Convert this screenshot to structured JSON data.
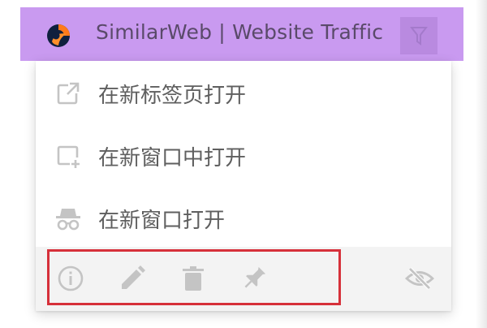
{
  "header": {
    "title": "SimilarWeb | Website Traffic",
    "brand_color": "#c99af0",
    "logo_icon": "similarweb-logo",
    "action_icon": "filter-funnel-icon"
  },
  "menu": {
    "items": [
      {
        "icon": "open-in-new-tab-icon",
        "label": "在新标签页打开"
      },
      {
        "icon": "open-in-new-window-icon",
        "label": "在新窗口中打开"
      },
      {
        "icon": "incognito-icon",
        "label": "在新窗口打开"
      }
    ]
  },
  "toolbar": {
    "icons": [
      "info-icon",
      "edit-pencil-icon",
      "trash-icon",
      "pin-icon",
      "hide-eye-icon"
    ]
  },
  "colors": {
    "highlight": "#d6303a",
    "icon_gray": "#c4c4c4",
    "text_gray": "#5f5f5f"
  }
}
